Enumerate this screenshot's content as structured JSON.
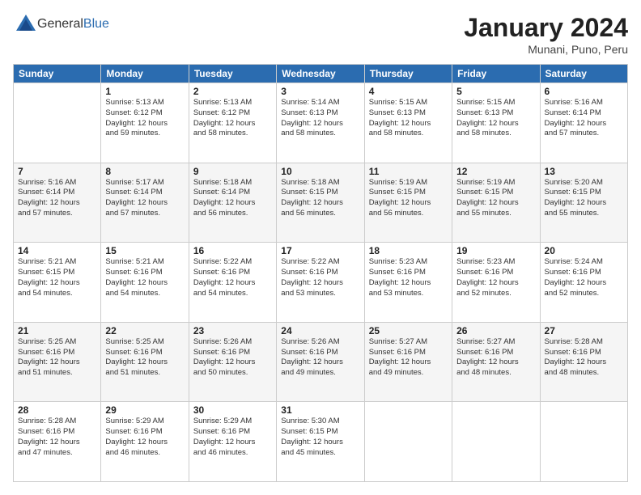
{
  "header": {
    "logo": {
      "general": "General",
      "blue": "Blue"
    },
    "title": "January 2024",
    "subtitle": "Munani, Puno, Peru"
  },
  "weekdays": [
    "Sunday",
    "Monday",
    "Tuesday",
    "Wednesday",
    "Thursday",
    "Friday",
    "Saturday"
  ],
  "weeks": [
    [
      {
        "day": "",
        "info": ""
      },
      {
        "day": "1",
        "info": "Sunrise: 5:13 AM\nSunset: 6:12 PM\nDaylight: 12 hours\nand 59 minutes."
      },
      {
        "day": "2",
        "info": "Sunrise: 5:13 AM\nSunset: 6:12 PM\nDaylight: 12 hours\nand 58 minutes."
      },
      {
        "day": "3",
        "info": "Sunrise: 5:14 AM\nSunset: 6:13 PM\nDaylight: 12 hours\nand 58 minutes."
      },
      {
        "day": "4",
        "info": "Sunrise: 5:15 AM\nSunset: 6:13 PM\nDaylight: 12 hours\nand 58 minutes."
      },
      {
        "day": "5",
        "info": "Sunrise: 5:15 AM\nSunset: 6:13 PM\nDaylight: 12 hours\nand 58 minutes."
      },
      {
        "day": "6",
        "info": "Sunrise: 5:16 AM\nSunset: 6:14 PM\nDaylight: 12 hours\nand 57 minutes."
      }
    ],
    [
      {
        "day": "7",
        "info": "Sunrise: 5:16 AM\nSunset: 6:14 PM\nDaylight: 12 hours\nand 57 minutes."
      },
      {
        "day": "8",
        "info": "Sunrise: 5:17 AM\nSunset: 6:14 PM\nDaylight: 12 hours\nand 57 minutes."
      },
      {
        "day": "9",
        "info": "Sunrise: 5:18 AM\nSunset: 6:14 PM\nDaylight: 12 hours\nand 56 minutes."
      },
      {
        "day": "10",
        "info": "Sunrise: 5:18 AM\nSunset: 6:15 PM\nDaylight: 12 hours\nand 56 minutes."
      },
      {
        "day": "11",
        "info": "Sunrise: 5:19 AM\nSunset: 6:15 PM\nDaylight: 12 hours\nand 56 minutes."
      },
      {
        "day": "12",
        "info": "Sunrise: 5:19 AM\nSunset: 6:15 PM\nDaylight: 12 hours\nand 55 minutes."
      },
      {
        "day": "13",
        "info": "Sunrise: 5:20 AM\nSunset: 6:15 PM\nDaylight: 12 hours\nand 55 minutes."
      }
    ],
    [
      {
        "day": "14",
        "info": "Sunrise: 5:21 AM\nSunset: 6:15 PM\nDaylight: 12 hours\nand 54 minutes."
      },
      {
        "day": "15",
        "info": "Sunrise: 5:21 AM\nSunset: 6:16 PM\nDaylight: 12 hours\nand 54 minutes."
      },
      {
        "day": "16",
        "info": "Sunrise: 5:22 AM\nSunset: 6:16 PM\nDaylight: 12 hours\nand 54 minutes."
      },
      {
        "day": "17",
        "info": "Sunrise: 5:22 AM\nSunset: 6:16 PM\nDaylight: 12 hours\nand 53 minutes."
      },
      {
        "day": "18",
        "info": "Sunrise: 5:23 AM\nSunset: 6:16 PM\nDaylight: 12 hours\nand 53 minutes."
      },
      {
        "day": "19",
        "info": "Sunrise: 5:23 AM\nSunset: 6:16 PM\nDaylight: 12 hours\nand 52 minutes."
      },
      {
        "day": "20",
        "info": "Sunrise: 5:24 AM\nSunset: 6:16 PM\nDaylight: 12 hours\nand 52 minutes."
      }
    ],
    [
      {
        "day": "21",
        "info": "Sunrise: 5:25 AM\nSunset: 6:16 PM\nDaylight: 12 hours\nand 51 minutes."
      },
      {
        "day": "22",
        "info": "Sunrise: 5:25 AM\nSunset: 6:16 PM\nDaylight: 12 hours\nand 51 minutes."
      },
      {
        "day": "23",
        "info": "Sunrise: 5:26 AM\nSunset: 6:16 PM\nDaylight: 12 hours\nand 50 minutes."
      },
      {
        "day": "24",
        "info": "Sunrise: 5:26 AM\nSunset: 6:16 PM\nDaylight: 12 hours\nand 49 minutes."
      },
      {
        "day": "25",
        "info": "Sunrise: 5:27 AM\nSunset: 6:16 PM\nDaylight: 12 hours\nand 49 minutes."
      },
      {
        "day": "26",
        "info": "Sunrise: 5:27 AM\nSunset: 6:16 PM\nDaylight: 12 hours\nand 48 minutes."
      },
      {
        "day": "27",
        "info": "Sunrise: 5:28 AM\nSunset: 6:16 PM\nDaylight: 12 hours\nand 48 minutes."
      }
    ],
    [
      {
        "day": "28",
        "info": "Sunrise: 5:28 AM\nSunset: 6:16 PM\nDaylight: 12 hours\nand 47 minutes."
      },
      {
        "day": "29",
        "info": "Sunrise: 5:29 AM\nSunset: 6:16 PM\nDaylight: 12 hours\nand 46 minutes."
      },
      {
        "day": "30",
        "info": "Sunrise: 5:29 AM\nSunset: 6:16 PM\nDaylight: 12 hours\nand 46 minutes."
      },
      {
        "day": "31",
        "info": "Sunrise: 5:30 AM\nSunset: 6:15 PM\nDaylight: 12 hours\nand 45 minutes."
      },
      {
        "day": "",
        "info": ""
      },
      {
        "day": "",
        "info": ""
      },
      {
        "day": "",
        "info": ""
      }
    ]
  ]
}
